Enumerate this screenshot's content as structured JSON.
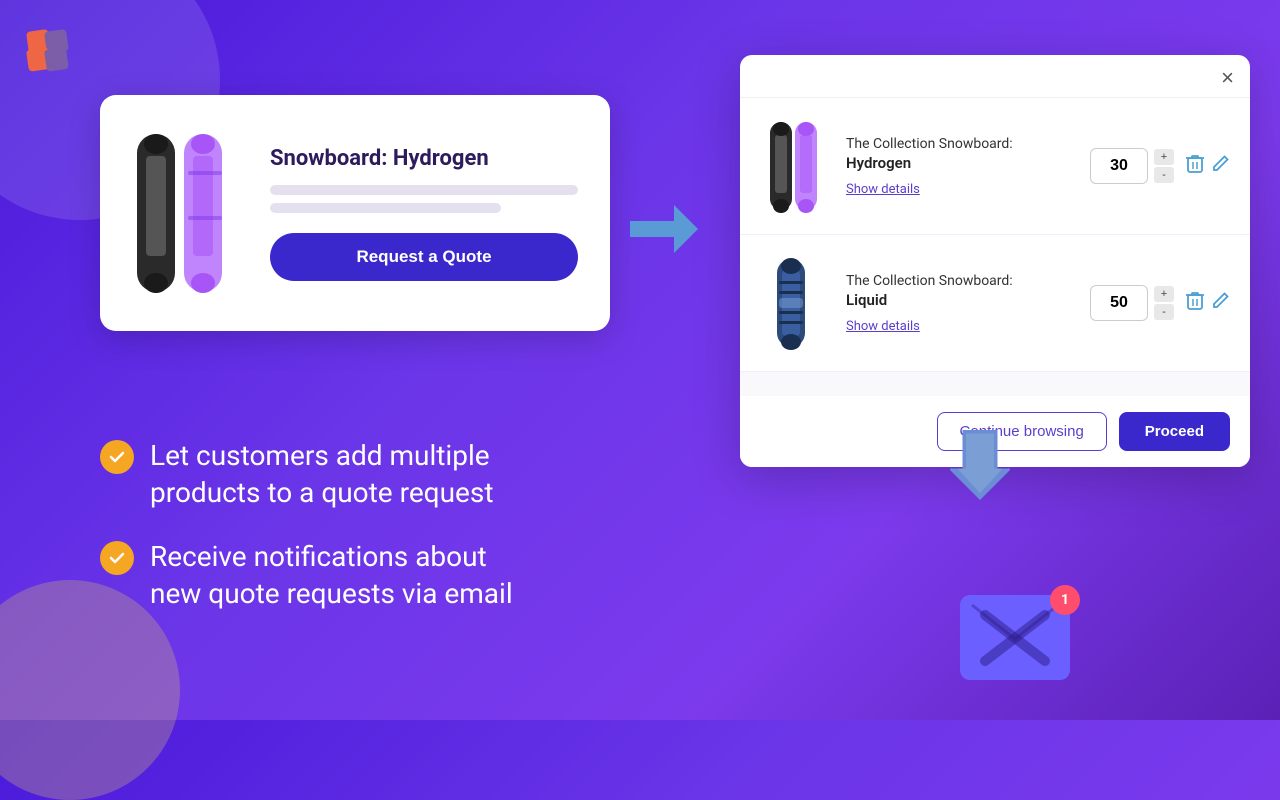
{
  "logo": {
    "alt": "DA Logo"
  },
  "product_card": {
    "title": "Snowboard: Hydrogen",
    "button_label": "Request a Quote"
  },
  "cart": {
    "close_label": "×",
    "items": [
      {
        "id": "item-1",
        "collection": "The Collection Snowboard:",
        "variant": "Hydrogen",
        "qty": 30,
        "show_details_label": "Show details"
      },
      {
        "id": "item-2",
        "collection": "The Collection Snowboard:",
        "variant": "Liquid",
        "qty": 50,
        "show_details_label": "Show details"
      }
    ],
    "footer": {
      "continue_label": "Continue browsing",
      "proceed_label": "Proceed"
    }
  },
  "features": [
    {
      "id": "feature-1",
      "text": "Let customers add multiple\nproducts to a quote request"
    },
    {
      "id": "feature-2",
      "text": "Receive notifications about\nnew quote requests via email"
    }
  ],
  "icons": {
    "plus": "+",
    "minus": "-",
    "trash": "🗑",
    "edit": "✏",
    "check": "✓",
    "close": "×",
    "notification": "1"
  },
  "colors": {
    "brand_purple": "#3b28cc",
    "accent_orange": "#f5a623",
    "link_purple": "#5c3ecc",
    "arrow_blue": "#5b9bd5"
  }
}
